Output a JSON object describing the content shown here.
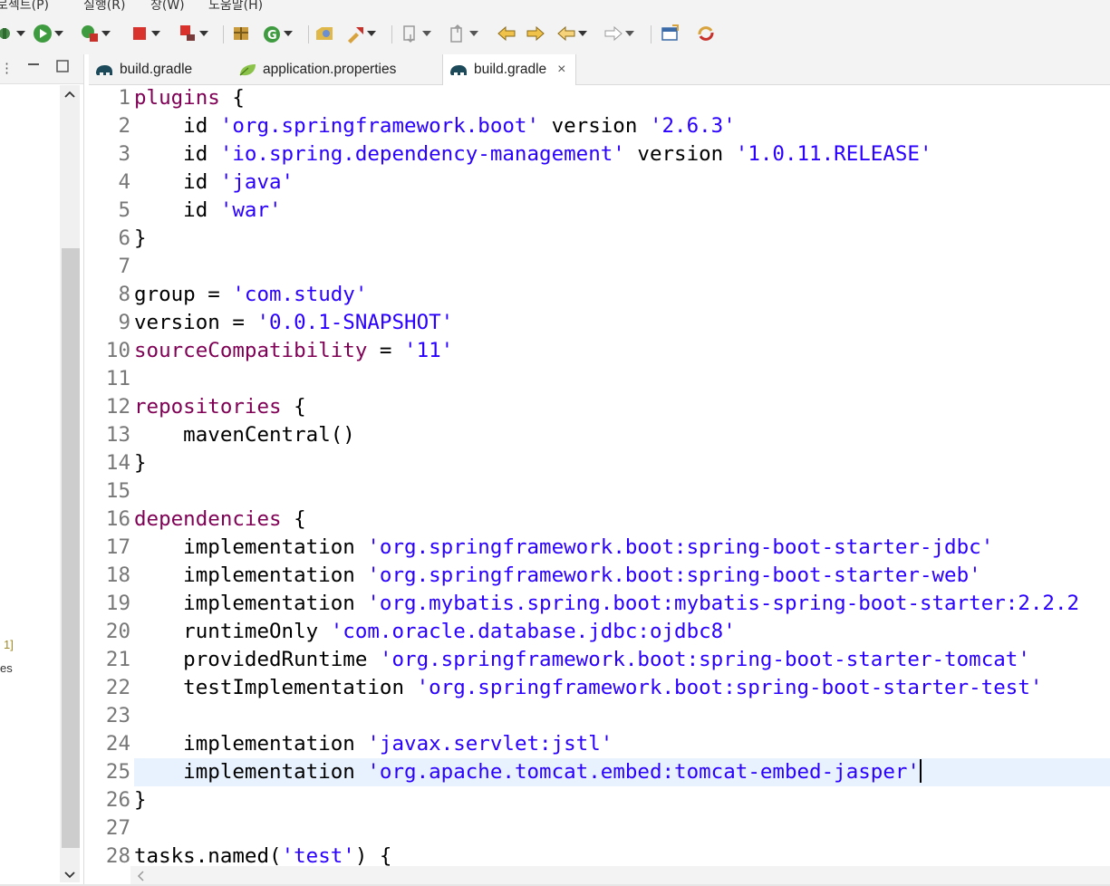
{
  "menu": {
    "items": [
      "로젝트(P)",
      "실행(R)",
      "창(W)",
      "도움말(H)"
    ]
  },
  "toolbar": {
    "icons": [
      "debug-icon",
      "run-icon",
      "external-tools-icon",
      "stop-icon",
      "disconnect-icon",
      "package-icon",
      "new-class-icon",
      "open-type-icon",
      "search-icon",
      "next-annotation-icon",
      "prev-annotation-icon",
      "last-edit-icon",
      "back-icon",
      "forward-icon",
      "open-perspective-icon",
      "sync-icon"
    ]
  },
  "left_panel": {
    "partial_text_1": "1]",
    "partial_text_2": "es"
  },
  "tabs": [
    {
      "label": "build.gradle",
      "icon": "gradle-elephant-icon",
      "active": false
    },
    {
      "label": "application.properties",
      "icon": "spring-leaf-icon",
      "active": false
    },
    {
      "label": "build.gradle",
      "icon": "gradle-elephant-icon",
      "active": true,
      "close": "×"
    }
  ],
  "editor": {
    "lines": [
      {
        "n": "1",
        "t": [
          [
            "kw",
            "plugins"
          ],
          [
            "p",
            " {"
          ]
        ]
      },
      {
        "n": "2",
        "t": [
          [
            "p",
            "    id "
          ],
          [
            "str",
            "'org.springframework.boot'"
          ],
          [
            "p",
            " version "
          ],
          [
            "str",
            "'2.6.3'"
          ]
        ]
      },
      {
        "n": "3",
        "t": [
          [
            "p",
            "    id "
          ],
          [
            "str",
            "'io.spring.dependency-management'"
          ],
          [
            "p",
            " version "
          ],
          [
            "str",
            "'1.0.11.RELEASE'"
          ]
        ]
      },
      {
        "n": "4",
        "t": [
          [
            "p",
            "    id "
          ],
          [
            "str",
            "'java'"
          ]
        ]
      },
      {
        "n": "5",
        "t": [
          [
            "p",
            "    id "
          ],
          [
            "str",
            "'war'"
          ]
        ]
      },
      {
        "n": "6",
        "t": [
          [
            "p",
            "}"
          ]
        ]
      },
      {
        "n": "7",
        "t": []
      },
      {
        "n": "8",
        "t": [
          [
            "p",
            "group = "
          ],
          [
            "str",
            "'com.study'"
          ]
        ]
      },
      {
        "n": "9",
        "t": [
          [
            "p",
            "version = "
          ],
          [
            "str",
            "'0.0.1-SNAPSHOT'"
          ]
        ]
      },
      {
        "n": "10",
        "t": [
          [
            "kw",
            "sourceCompatibility"
          ],
          [
            "p",
            " = "
          ],
          [
            "str",
            "'11'"
          ]
        ]
      },
      {
        "n": "11",
        "t": []
      },
      {
        "n": "12",
        "t": [
          [
            "kw",
            "repositories"
          ],
          [
            "p",
            " {"
          ]
        ]
      },
      {
        "n": "13",
        "t": [
          [
            "p",
            "    mavenCentral()"
          ]
        ]
      },
      {
        "n": "14",
        "t": [
          [
            "p",
            "}"
          ]
        ]
      },
      {
        "n": "15",
        "t": []
      },
      {
        "n": "16",
        "t": [
          [
            "kw",
            "dependencies"
          ],
          [
            "p",
            " {"
          ]
        ]
      },
      {
        "n": "17",
        "t": [
          [
            "p",
            "    implementation "
          ],
          [
            "str",
            "'org.springframework.boot:spring-boot-starter-jdbc'"
          ]
        ]
      },
      {
        "n": "18",
        "t": [
          [
            "p",
            "    implementation "
          ],
          [
            "str",
            "'org.springframework.boot:spring-boot-starter-web'"
          ]
        ]
      },
      {
        "n": "19",
        "t": [
          [
            "p",
            "    implementation "
          ],
          [
            "str",
            "'org.mybatis.spring.boot:mybatis-spring-boot-starter:2.2.2"
          ]
        ]
      },
      {
        "n": "20",
        "t": [
          [
            "p",
            "    runtimeOnly "
          ],
          [
            "str",
            "'com.oracle.database.jdbc:ojdbc8'"
          ]
        ]
      },
      {
        "n": "21",
        "t": [
          [
            "p",
            "    providedRuntime "
          ],
          [
            "str",
            "'org.springframework.boot:spring-boot-starter-tomcat'"
          ]
        ]
      },
      {
        "n": "22",
        "t": [
          [
            "p",
            "    testImplementation "
          ],
          [
            "str",
            "'org.springframework.boot:spring-boot-starter-test'"
          ]
        ]
      },
      {
        "n": "23",
        "t": []
      },
      {
        "n": "24",
        "t": [
          [
            "p",
            "    implementation "
          ],
          [
            "str",
            "'javax.servlet:jstl'"
          ]
        ]
      },
      {
        "n": "25",
        "t": [
          [
            "p",
            "    implementation "
          ],
          [
            "str",
            "'org.apache.tomcat.embed:tomcat-embed-jasper'"
          ]
        ]
      },
      {
        "n": "26",
        "t": [
          [
            "p",
            "}"
          ]
        ]
      },
      {
        "n": "27",
        "t": []
      },
      {
        "n": "28",
        "t": [
          [
            "p",
            "tasks.named("
          ],
          [
            "str",
            "'test'"
          ],
          [
            "p",
            ") {"
          ]
        ]
      }
    ],
    "highlighted_line": 25
  },
  "colors": {
    "keyword": "#7f0055",
    "string": "#2a00ff",
    "line_number": "#787878",
    "current_line": "#e8f2fe"
  }
}
